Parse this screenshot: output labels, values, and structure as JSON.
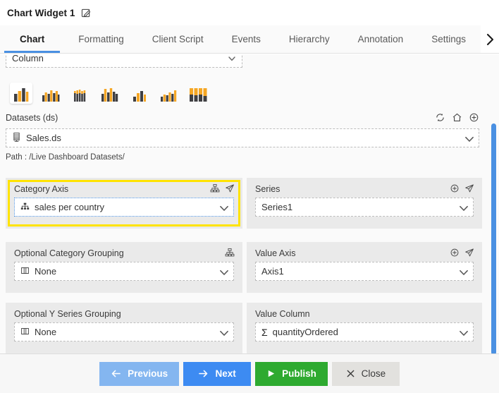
{
  "window": {
    "title": "Chart Widget 1",
    "edit_icon": "edit-pencil-icon"
  },
  "tabs": [
    {
      "label": "Chart",
      "active": true
    },
    {
      "label": "Formatting",
      "active": false
    },
    {
      "label": "Client Script",
      "active": false
    },
    {
      "label": "Events",
      "active": false
    },
    {
      "label": "Hierarchy",
      "active": false
    },
    {
      "label": "Annotation",
      "active": false
    },
    {
      "label": "Settings",
      "active": false
    }
  ],
  "tab_scroll_right_icon": "chevron-right-icon",
  "chart_type": {
    "selected": "Column",
    "dropdown_icon": "chevron-down-icon",
    "variants": [
      {
        "name": "column-chart-icon",
        "selected": true
      },
      {
        "name": "clustered-column-chart-icon",
        "selected": false
      },
      {
        "name": "stacked-column-chart-icon",
        "selected": false
      },
      {
        "name": "grouped-column-chart-icon",
        "selected": false
      },
      {
        "name": "small-column-chart-icon",
        "selected": false
      },
      {
        "name": "mixed-column-chart-icon",
        "selected": false
      },
      {
        "name": "full-stacked-column-chart-icon",
        "selected": false
      }
    ]
  },
  "datasets": {
    "label": "Datasets (ds)",
    "value": "Sales.ds",
    "value_icon": "database-icon",
    "dropdown_icon": "chevron-down-icon",
    "path": "Path : /Live Dashboard Datasets/",
    "actions": [
      {
        "name": "refresh-icon"
      },
      {
        "name": "home-icon"
      },
      {
        "name": "add-icon"
      }
    ]
  },
  "category_axis": {
    "label": "Category Axis",
    "value": "sales per country",
    "value_icon": "hierarchy-icon",
    "dropdown_icon": "chevron-down-icon",
    "highlighted": true,
    "actions": [
      {
        "name": "sitemap-icon"
      },
      {
        "name": "send-icon"
      }
    ]
  },
  "series": {
    "label": "Series",
    "value": "Series1",
    "dropdown_icon": "chevron-down-icon",
    "actions": [
      {
        "name": "add-circle-icon"
      },
      {
        "name": "send-icon"
      }
    ]
  },
  "category_grouping": {
    "label": "Optional Category Grouping",
    "value": "None",
    "value_icon": "column-icon",
    "dropdown_icon": "chevron-down-icon",
    "actions": [
      {
        "name": "sitemap-icon"
      }
    ]
  },
  "value_axis": {
    "label": "Value Axis",
    "value": "Axis1",
    "dropdown_icon": "chevron-down-icon",
    "actions": [
      {
        "name": "add-circle-icon"
      },
      {
        "name": "send-icon"
      }
    ]
  },
  "y_series_grouping": {
    "label": "Optional Y Series Grouping",
    "value": "None",
    "value_icon": "column-icon",
    "dropdown_icon": "chevron-down-icon"
  },
  "value_column": {
    "label": "Value Column",
    "value": "quantityOrdered",
    "value_icon": "sigma-icon",
    "dropdown_icon": "chevron-down-icon"
  },
  "footer": {
    "previous": "Previous",
    "next": "Next",
    "publish": "Publish",
    "close": "Close"
  },
  "colors": {
    "accent_blue": "#4a90e2",
    "next_blue": "#3d8bf2",
    "prev_blue": "#84b6f0",
    "publish_green": "#2eaa30",
    "close_grey": "#e2e1de",
    "highlight_yellow": "#ffe300",
    "panel_grey": "#eaeaea",
    "content_bg": "#fafafa",
    "chart_orange": "#f5a623",
    "chart_dark": "#3f3f42"
  }
}
